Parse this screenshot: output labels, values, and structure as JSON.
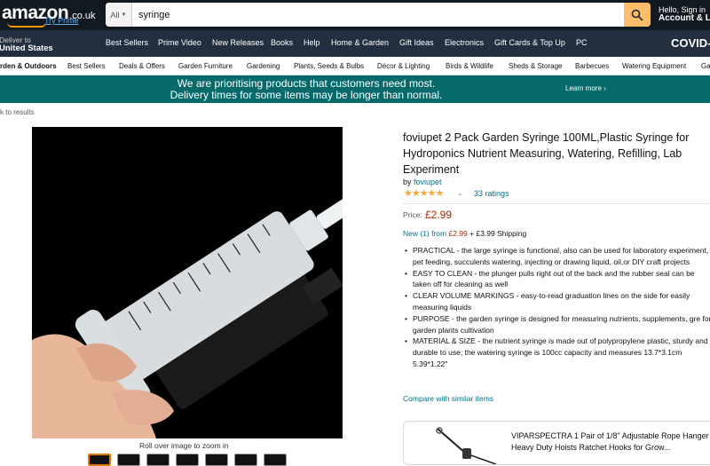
{
  "header": {
    "logo_text": "amazon",
    "logo_tld": ".co.uk",
    "try_prime": "Try Prime",
    "search_category": "All",
    "search_value": "syringe",
    "hello_line1": "Hello, Sign in",
    "hello_line2": "Account & Lis"
  },
  "nav2": {
    "deliver_line1": "Deliver to",
    "deliver_line2": "United States",
    "items": [
      "Best Sellers",
      "Prime Video",
      "New Releases",
      "Books",
      "Help",
      "Home & Garden",
      "Gift Ideas",
      "Electronics",
      "Gift Cards & Top Up",
      "PC"
    ],
    "covid": "COVID-"
  },
  "nav3": {
    "items": [
      "rden & Outdoors",
      "Best Sellers",
      "Deals & Offers",
      "Garden Furniture",
      "Gardening",
      "Plants, Seeds & Bulbs",
      "Décor & Lighting",
      "Birds & Wildlife",
      "Sheds & Storage",
      "Barbecues",
      "Watering Equipment",
      "Ga"
    ]
  },
  "banner": {
    "line1": "We are prioritising products that customers need most.",
    "line2": "Delivery times for some items may be longer than normal.",
    "learn_more": "Learn more ›"
  },
  "breadcrumb": {
    "back": "k to results"
  },
  "product": {
    "image_caption": "Roll over image to zoom in",
    "thumb_count": 7,
    "title": "foviupet 2 Pack Garden Syringe 100ML,Plastic Syringe for Hydroponics Nutrient Measuring, Watering, Refilling, Lab Experiment",
    "by_label": "by",
    "brand": "foviupet",
    "stars": "★★★★★",
    "rating_value": 4.5,
    "ratings": "33 ratings",
    "price_label": "Price:",
    "price": "£2.99",
    "new_from_link": "New (1) from",
    "new_from_price": "£2.99",
    "new_from_shipping": "+ £3.99 Shipping",
    "bullets": [
      "PRACTICAL - the large syringe is functional, also can be used for laboratory experiment, pet feeding, succulents watering, injecting or drawing liquid, oil,or DIY craft projects",
      "EASY TO CLEAN - the plunger pulls right out of the back and the rubber seal can be taken off for cleaning as well",
      "CLEAR VOLUME MARKINGS - easy-to-read graduation lines on the side for easily measuring liquids",
      "PURPOSE - the garden syringe is designed for measuring nutrients, supplements, gre for garden plants cultivation",
      "MATERIAL & SIZE - the nutrient syringe is made out of polypropylene plastic, sturdy and durable to use; the watering syringe is 100cc capacity and measures 13.7*3.1cm 5.39*1.22\""
    ],
    "compare": "Compare with similar items"
  },
  "sponsored": {
    "title": "VIPARSPECTRA 1 Pair of 1/8\" Adjustable Rope Hanger Heavy Duty Hoists Ratchet Hooks for Grow..."
  },
  "colors": {
    "topnav": "#131921",
    "nav2": "#232f3e",
    "banner": "#076a6a",
    "link": "#007185",
    "price": "#b12704",
    "star": "#f2a742",
    "search_button": "#febd69"
  }
}
